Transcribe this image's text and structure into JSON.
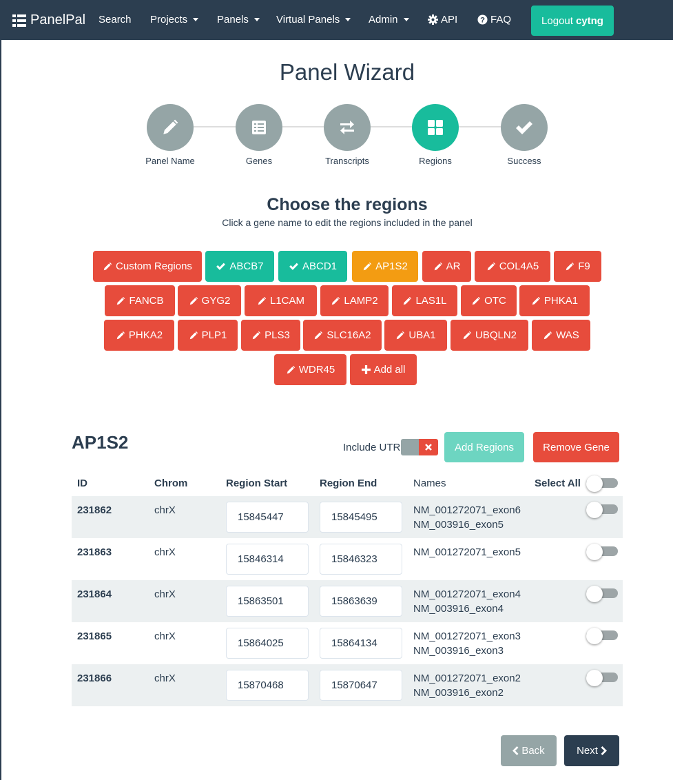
{
  "navbar": {
    "brand": "PanelPal",
    "items": [
      {
        "label": "Search"
      },
      {
        "label": "Projects"
      },
      {
        "label": "Panels"
      },
      {
        "label": "Virtual Panels"
      },
      {
        "label": "Admin"
      },
      {
        "label": "API"
      },
      {
        "label": "FAQ"
      }
    ],
    "logout_label": "Logout",
    "username": "cytng"
  },
  "wizard": {
    "title": "Panel Wizard",
    "steps": [
      {
        "label": "Panel Name",
        "icon": "pencil-icon"
      },
      {
        "label": "Genes",
        "icon": "list-icon"
      },
      {
        "label": "Transcripts",
        "icon": "exchange-icon"
      },
      {
        "label": "Regions",
        "icon": "grid-icon",
        "active": true
      },
      {
        "label": "Success",
        "icon": "check-icon"
      }
    ]
  },
  "regions_section": {
    "title": "Choose the regions",
    "subtitle": "Click a gene name to edit the regions included in the panel",
    "gene_buttons": [
      {
        "label": "Custom Regions",
        "state": "edit"
      },
      {
        "label": "ABCB7",
        "state": "done"
      },
      {
        "label": "ABCD1",
        "state": "done"
      },
      {
        "label": "AP1S2",
        "state": "current"
      },
      {
        "label": "AR",
        "state": "edit"
      },
      {
        "label": "COL4A5",
        "state": "edit"
      },
      {
        "label": "F9",
        "state": "edit"
      },
      {
        "label": "FANCB",
        "state": "edit"
      },
      {
        "label": "GYG2",
        "state": "edit"
      },
      {
        "label": "L1CAM",
        "state": "edit"
      },
      {
        "label": "LAMP2",
        "state": "edit"
      },
      {
        "label": "LAS1L",
        "state": "edit"
      },
      {
        "label": "OTC",
        "state": "edit"
      },
      {
        "label": "PHKA1",
        "state": "edit"
      },
      {
        "label": "PHKA2",
        "state": "edit"
      },
      {
        "label": "PLP1",
        "state": "edit"
      },
      {
        "label": "PLS3",
        "state": "edit"
      },
      {
        "label": "SLC16A2",
        "state": "edit"
      },
      {
        "label": "UBA1",
        "state": "edit"
      },
      {
        "label": "UBQLN2",
        "state": "edit"
      },
      {
        "label": "WAS",
        "state": "edit"
      },
      {
        "label": "WDR45",
        "state": "edit"
      },
      {
        "label": "Add all",
        "state": "add"
      }
    ],
    "colors": {
      "edit": "#e74c3c",
      "done": "#18bc9c",
      "current": "#f39c12"
    }
  },
  "gene_panel": {
    "gene": "AP1S2",
    "include_utr_label": "Include UTR",
    "include_utr_on": false,
    "add_regions_label": "Add Regions",
    "remove_gene_label": "Remove Gene",
    "columns": [
      "ID",
      "Chrom",
      "Region Start",
      "Region End",
      "Names",
      "Select All"
    ],
    "rows": [
      {
        "id": "231862",
        "chrom": "chrX",
        "start": "15845447",
        "end": "15845495",
        "names": [
          "NM_001272071_exon6",
          "NM_003916_exon5"
        ],
        "selected": false
      },
      {
        "id": "231863",
        "chrom": "chrX",
        "start": "15846314",
        "end": "15846323",
        "names": [
          "NM_001272071_exon5"
        ],
        "selected": false
      },
      {
        "id": "231864",
        "chrom": "chrX",
        "start": "15863501",
        "end": "15863639",
        "names": [
          "NM_001272071_exon4",
          "NM_003916_exon4"
        ],
        "selected": false
      },
      {
        "id": "231865",
        "chrom": "chrX",
        "start": "15864025",
        "end": "15864134",
        "names": [
          "NM_001272071_exon3",
          "NM_003916_exon3"
        ],
        "selected": false
      },
      {
        "id": "231866",
        "chrom": "chrX",
        "start": "15870468",
        "end": "15870647",
        "names": [
          "NM_001272071_exon2",
          "NM_003916_exon2"
        ],
        "selected": false
      }
    ]
  },
  "footer": {
    "back_label": "Back",
    "next_label": "Next"
  }
}
